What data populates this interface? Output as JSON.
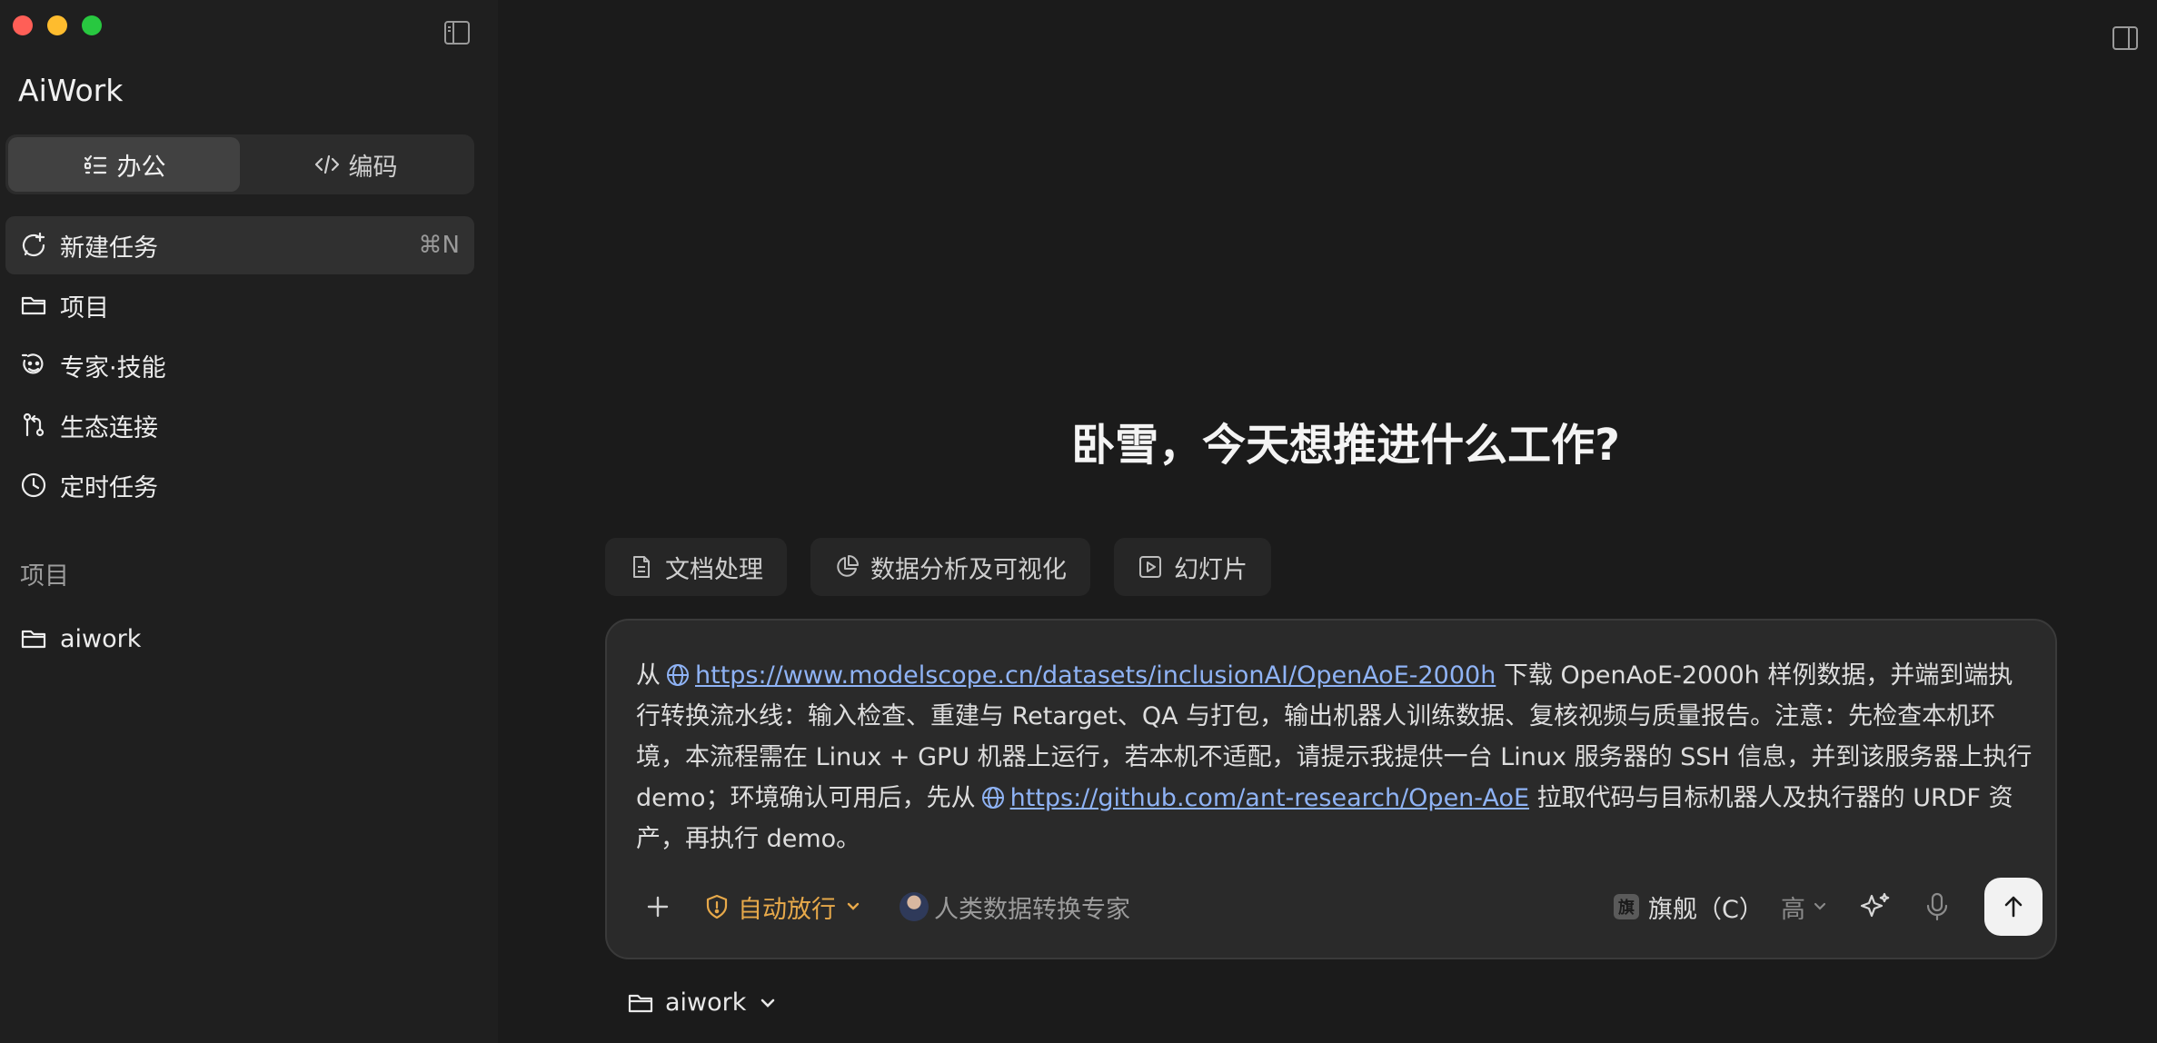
{
  "app": {
    "title": "AiWork"
  },
  "modes": [
    {
      "label": "办公",
      "icon": "list-check-icon",
      "active": true
    },
    {
      "label": "编码",
      "icon": "code-icon",
      "active": false
    }
  ],
  "nav": {
    "new_task": {
      "label": "新建任务",
      "shortcut": "⌘N",
      "icon": "new-chat-icon"
    },
    "projects": {
      "label": "项目",
      "icon": "folder-icon"
    },
    "experts": {
      "label": "专家·技能",
      "icon": "bot-face-icon"
    },
    "ecosystem": {
      "label": "生态连接",
      "icon": "git-branch-icon"
    },
    "scheduled": {
      "label": "定时任务",
      "icon": "clock-icon"
    }
  },
  "project_section": {
    "label": "项目",
    "items": [
      {
        "label": "aiwork",
        "icon": "folder-icon"
      }
    ]
  },
  "main": {
    "greeting": "卧雪，今天想推进什么工作?",
    "chips": [
      {
        "label": "文档处理",
        "icon": "document-icon"
      },
      {
        "label": "数据分析及可视化",
        "icon": "pie-chart-icon"
      },
      {
        "label": "幻灯片",
        "icon": "play-slide-icon"
      }
    ],
    "composer": {
      "text_1": "从",
      "link_1": "https://www.modelscope.cn/datasets/inclusionAI/OpenAoE-2000h",
      "text_2": " 下载 OpenAoE-2000h 样例数据，并端到端执行转换流水线：输入检查、重建与 Retarget、QA 与打包，输出机器人训练数据、复核视频与质量报告。注意：先检查本机环境，本流程需在 Linux + GPU 机器上运行，若本机不适配，请提示我提供一台 Linux 服务器的 SSH 信息，并到该服务器上执行 demo；环境确认可用后，先从",
      "link_2": "https://github.com/ant-research/Open-AoE",
      "text_3": " 拉取代码与目标机器人及执行器的 URDF 资产，再执行 demo。",
      "approval_mode": "自动放行",
      "expert": "人类数据转换专家",
      "model_badge": "旗",
      "model": "旗舰（C）",
      "effort": "高"
    },
    "folder": "aiwork"
  },
  "colors": {
    "accent_orange": "#e7a94a",
    "link_blue": "#8fb3f5",
    "background": "#1b1b1b",
    "sidebar": "#1f1f1f"
  }
}
